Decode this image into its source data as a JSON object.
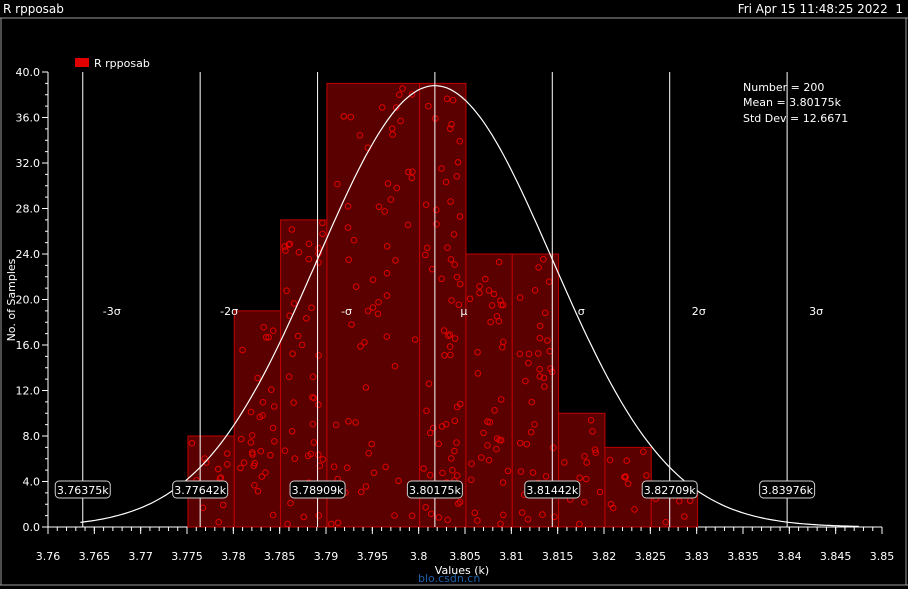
{
  "window": {
    "title": "R rpposab",
    "timestamp": "Fri Apr 15 11:48:25 2022",
    "page": "1"
  },
  "colors": {
    "background": "#000000",
    "bar_fill": "#5a0000",
    "bar_edge": "#c00000",
    "marker": "#e00000",
    "curve": "#ffffff",
    "guide": "#ffffff"
  },
  "watermark": "blo.csdn.cn",
  "chart_data": {
    "type": "bar",
    "title": "",
    "legend": {
      "label": "R rpposab",
      "placement": "top-left"
    },
    "xlabel": "Values (k)",
    "ylabel": "No. of Samples",
    "xlim": [
      3.76,
      3.85
    ],
    "ylim": [
      0,
      40
    ],
    "x_ticks": [
      "3.76",
      "3.765",
      "3.77",
      "3.775",
      "3.78",
      "3.785",
      "3.79",
      "3.795",
      "3.8",
      "3.805",
      "3.81",
      "3.815",
      "3.82",
      "3.825",
      "3.83",
      "3.835",
      "3.84",
      "3.845",
      "3.85"
    ],
    "y_ticks": [
      "0.0",
      "4.0",
      "8.0",
      "12.0",
      "16.0",
      "20.0",
      "24.0",
      "28.0",
      "32.0",
      "36.0",
      "40.0"
    ],
    "bins": [
      {
        "x0": 3.7751,
        "x1": 3.7801,
        "count": 8
      },
      {
        "x0": 3.7801,
        "x1": 3.7851,
        "count": 19
      },
      {
        "x0": 3.7851,
        "x1": 3.7901,
        "count": 27
      },
      {
        "x0": 3.7901,
        "x1": 3.8001,
        "count": 39
      },
      {
        "x0": 3.8001,
        "x1": 3.8051,
        "count": 39
      },
      {
        "x0": 3.8051,
        "x1": 3.8101,
        "count": 24
      },
      {
        "x0": 3.8101,
        "x1": 3.8151,
        "count": 24
      },
      {
        "x0": 3.8151,
        "x1": 3.8201,
        "count": 10
      },
      {
        "x0": 3.8201,
        "x1": 3.8251,
        "count": 7
      },
      {
        "x0": 3.8251,
        "x1": 3.8301,
        "count": 3
      }
    ],
    "sigma_lines": [
      {
        "label": "-3σ",
        "x": 3.76375,
        "value_label": "3.76375k"
      },
      {
        "label": "-2σ",
        "x": 3.77642,
        "value_label": "3.77642k"
      },
      {
        "label": "-σ",
        "x": 3.78909,
        "value_label": "3.78909k"
      },
      {
        "label": "μ",
        "x": 3.80175,
        "value_label": "3.80175k"
      },
      {
        "label": "σ",
        "x": 3.81442,
        "value_label": "3.81442k"
      },
      {
        "label": "2σ",
        "x": 3.82709,
        "value_label": "3.82709k"
      },
      {
        "label": "3σ",
        "x": 3.83976,
        "value_label": "3.83976k"
      }
    ],
    "stats": {
      "number": "Number = 200",
      "mean": "Mean = 3.80175k",
      "std": "Std Dev = 12.6671"
    },
    "curve": {
      "mean": 3.80175,
      "sd": 0.0126671,
      "peak": 38.8
    }
  }
}
